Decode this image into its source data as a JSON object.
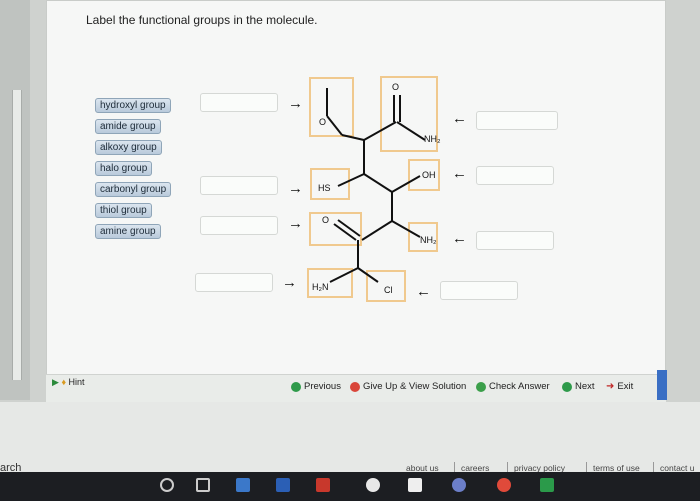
{
  "question": {
    "title": "Label the functional groups in the molecule."
  },
  "labels": [
    {
      "text": "hydroxyl group"
    },
    {
      "text": "amide group"
    },
    {
      "text": "alkoxy group"
    },
    {
      "text": "halo group"
    },
    {
      "text": "carbonyl group"
    },
    {
      "text": "thiol group"
    },
    {
      "text": "amine group"
    }
  ],
  "molecule": {
    "o_top": "O",
    "o_left": "O",
    "nh2_top": "NH₂",
    "oh": "OH",
    "hs": "HS",
    "o_mid": "O",
    "nh2_mid": "NH₂",
    "h2n": "H₂N",
    "cl": "Cl",
    "arrow_right": "→",
    "arrow_left": "←"
  },
  "toolbar": {
    "hint": "Hint",
    "previous": "Previous",
    "give_up": "Give Up & View Solution",
    "check": "Check Answer",
    "next": "Next",
    "exit": "Exit"
  },
  "footer": {
    "about": "about us",
    "careers": "careers",
    "privacy": "privacy policy",
    "terms": "terms of use",
    "contact": "contact u",
    "search_fragment": "arch"
  },
  "colors": {
    "chip_border": "#8fa5b8",
    "highlight": "#f0c98e",
    "previous_icon": "#2e9a4a",
    "giveup_icon": "#d9463a",
    "check_icon": "#3b9f4a",
    "next_icon": "#2e9a4a"
  }
}
